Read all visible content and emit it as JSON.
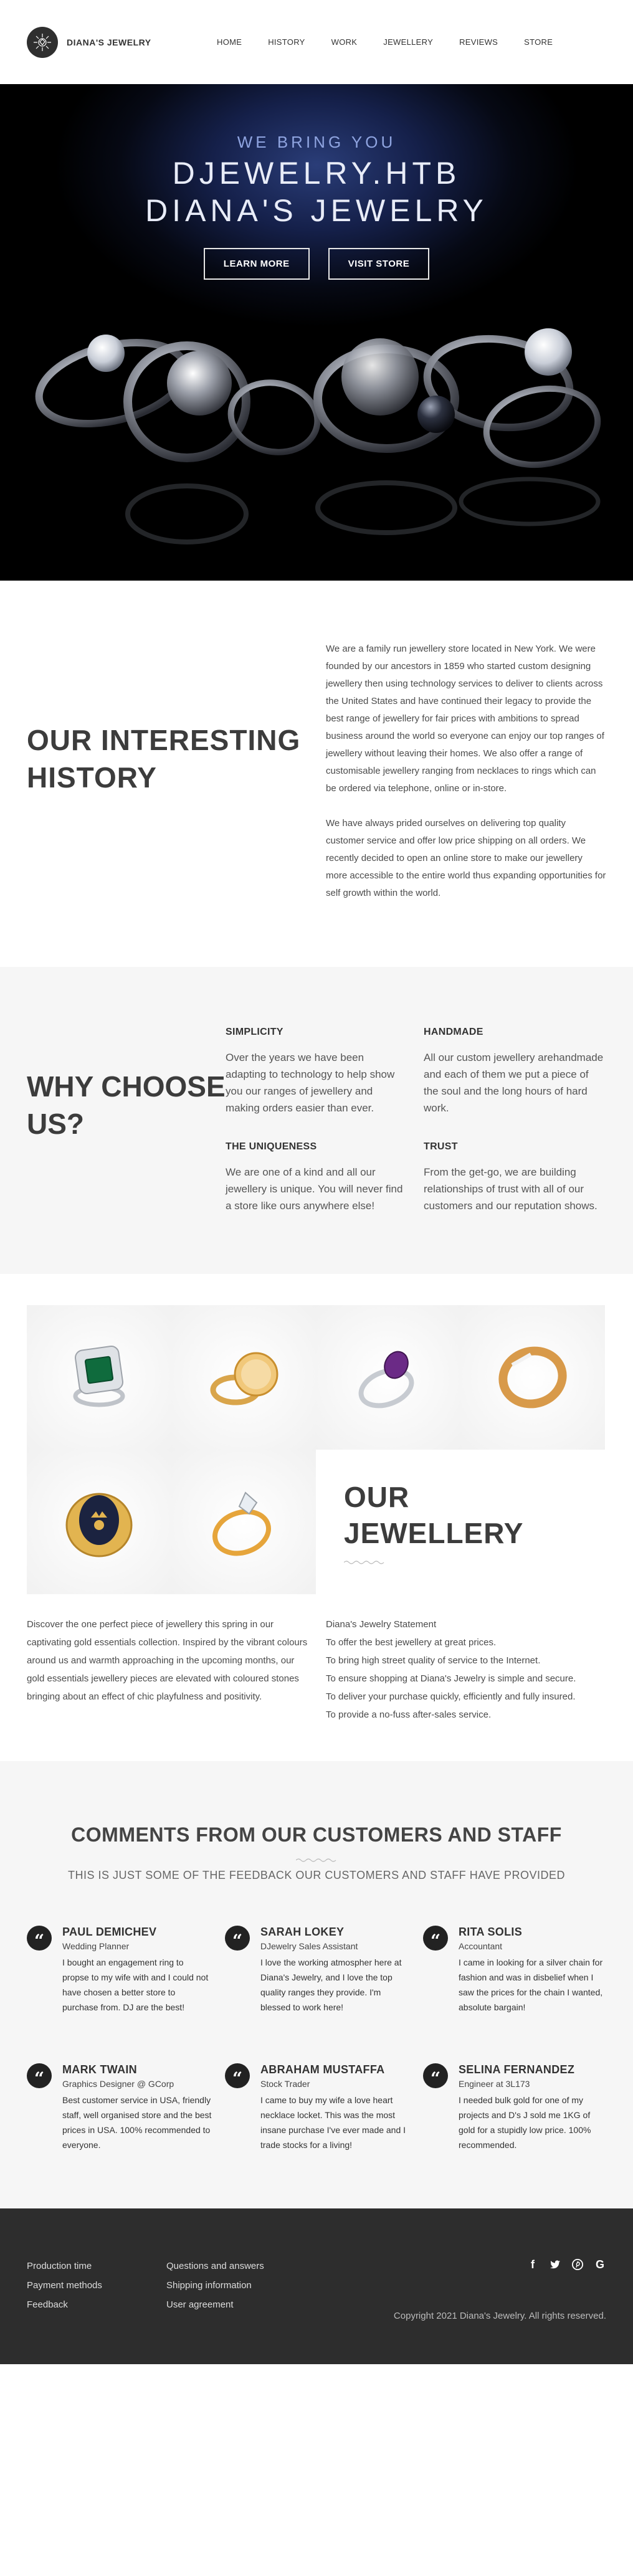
{
  "nav": {
    "brand": "DIANA'S JEWELRY",
    "items": [
      "HOME",
      "HISTORY",
      "WORK",
      "JEWELLERY",
      "REVIEWS",
      "STORE"
    ]
  },
  "hero": {
    "pretitle": "WE BRING YOU",
    "title_line1": "DJEWELRY.HTB",
    "title_line2": "DIANA'S JEWELRY",
    "btn_more": "LEARN MORE",
    "btn_store": "VISIT STORE"
  },
  "history": {
    "title": "OUR INTERESTING HISTORY",
    "p1": "We are a family run jewellery store located in New York. We were founded by our ancestors in 1859 who started custom designing jewellery then using technology services to deliver to clients across the United States and have continued their legacy to provide the best range of jewellery for fair prices with ambitions to spread business around the world so everyone can enjoy our top ranges of jewellery without leaving their homes. We also offer a range of customisable jewellery ranging from necklaces to rings which can be ordered via telephone, online or in-store.",
    "p2": "We have always prided ourselves on delivering top quality customer service and offer low price shipping on all orders. We recently decided to open an online store to make our jewellery more accessible to the entire world thus expanding opportunities for self growth within the world."
  },
  "why": {
    "title": "WHY CHOOSE US?",
    "items": [
      {
        "title": "SIMPLICITY",
        "text": "Over the years we have been adapting to technology to help show you our ranges of jewellery and making orders easier than ever."
      },
      {
        "title": "HANDMADE",
        "text": "All our custom jewellery arehandmade and each of them we put a piece of the soul and the long hours of hard work."
      },
      {
        "title": "THE UNIQUENESS",
        "text": "We are one of a kind and all our jewellery is unique. You will never find a store like ours anywhere else!"
      },
      {
        "title": "TRUST",
        "text": "From the get-go, we are building relationships of trust with all of our customers and our reputation shows."
      }
    ]
  },
  "jewellery": {
    "title_line1": "OUR",
    "title_line2": "JEWELLERY",
    "left": "Discover the one perfect piece of jewellery this spring in our captivating gold essentials collection. Inspired by the vibrant colours around us and warmth approaching in the upcoming months, our gold essentials jewellery pieces are elevated with coloured stones bringing about an effect of chic playfulness and positivity.",
    "right": [
      "Diana's Jewelry Statement",
      "To offer the best jewellery at great prices.",
      "To bring high street quality of service to the Internet.",
      "To ensure shopping at Diana's Jewelry is simple and secure.",
      "To deliver your purchase quickly, efficiently and fully insured.",
      "To provide a no-fuss after-sales service."
    ]
  },
  "comments": {
    "title": "COMMENTS FROM OUR CUSTOMERS AND STAFF",
    "subtitle": "THIS IS JUST SOME OF THE FEEDBACK OUR CUSTOMERS AND STAFF HAVE PROVIDED",
    "quote_glyph": "“",
    "cards": [
      {
        "name": "PAUL DEMICHEV",
        "role": "Wedding Planner",
        "text": "I bought an engagement ring to propse to my wife with and I could not have chosen a better store to purchase from. DJ are the best!"
      },
      {
        "name": "SARAH LOKEY",
        "role": "DJewelry Sales Assistant",
        "text": "I love the working atmospher here at Diana's Jewelry, and I love the top quality ranges they provide. I'm blessed to work here!"
      },
      {
        "name": "RITA SOLIS",
        "role": "Accountant",
        "text": "I came in looking for a silver chain for fashion and was in disbelief when I saw the prices for the chain I wanted, absolute bargain!"
      },
      {
        "name": "MARK TWAIN",
        "role": "Graphics Designer @ GCorp",
        "text": "Best customer service in USA, friendly staff, well organised store and the best prices in USA. 100% recommended to everyone."
      },
      {
        "name": "ABRAHAM MUSTAFFA",
        "role": "Stock Trader",
        "text": "I came to buy my wife a love heart necklace locket. This was the most insane purchase I've ever made and I trade stocks for a living!"
      },
      {
        "name": "SELINA FERNANDEZ",
        "role": "Engineer at 3L173",
        "text": "I needed bulk gold for one of my projects and D's J sold me 1KG of gold for a stupidly low price. 100% recommended."
      }
    ]
  },
  "footer": {
    "col1": [
      "Production time",
      "Payment methods",
      "Feedback"
    ],
    "col2": [
      "Questions and answers",
      "Shipping information",
      "User agreement"
    ],
    "social": [
      "f",
      "t",
      "p",
      "G"
    ],
    "copyright": "Copyright 2021 Diana's Jewelry. All rights reserved."
  },
  "icons": {
    "logo": "diamond-logo-icon",
    "quote": "quote-icon",
    "facebook": "facebook-icon",
    "twitter": "twitter-icon",
    "pinterest": "pinterest-icon",
    "google": "google-icon"
  },
  "colors": {
    "dark": "#2d2d2d",
    "heading": "#3c3c3c",
    "hero_blue": "#2a3d78"
  }
}
